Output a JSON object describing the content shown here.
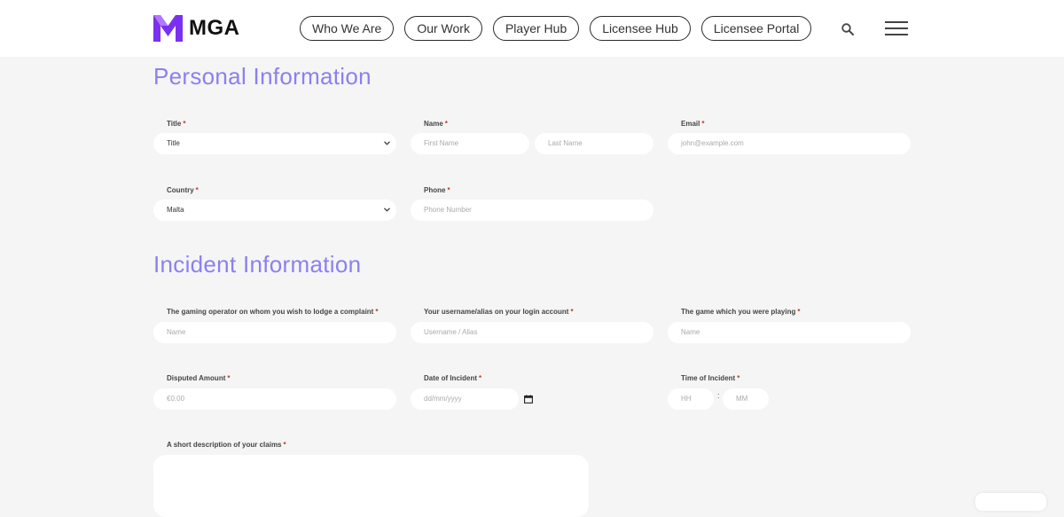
{
  "header": {
    "logo_text": "MGA",
    "logo_colors": {
      "primary": "#7b2ff0",
      "secondary": "#b079ff"
    },
    "nav": [
      "Who We Are",
      "Our Work",
      "Player Hub",
      "Licensee Hub",
      "Licensee Portal"
    ],
    "search_icon": "search-icon",
    "menu_icon": "hamburger-icon"
  },
  "accent_color": "#8b80f0",
  "personal": {
    "title": "Personal Information",
    "title_label": "Title",
    "title_value": "Title",
    "name_label": "Name",
    "first_name_placeholder": "First Name",
    "last_name_placeholder": "Last Name",
    "email_label": "Email",
    "email_placeholder": "john@example.com",
    "country_label": "Country",
    "country_value": "Malta",
    "phone_label": "Phone",
    "phone_placeholder": "Phone Number"
  },
  "incident": {
    "title": "Incident Information",
    "operator_label": "The gaming operator on whom you wish to lodge a complaint",
    "operator_placeholder": "Name",
    "username_label": "Your username/alias on your login account",
    "username_placeholder": "Username / Alias",
    "game_label": "The game which you were playing",
    "game_placeholder": "Name",
    "amount_label": "Disputed Amount",
    "amount_placeholder": "€0.00",
    "date_label": "Date of Incident",
    "date_placeholder": "dd/mm/yyyy",
    "time_label": "Time of Incident",
    "hour_placeholder": "HH",
    "time_separator": ":",
    "minute_placeholder": "MM",
    "description_label": "A short description of your claims"
  },
  "required_marker": "*"
}
